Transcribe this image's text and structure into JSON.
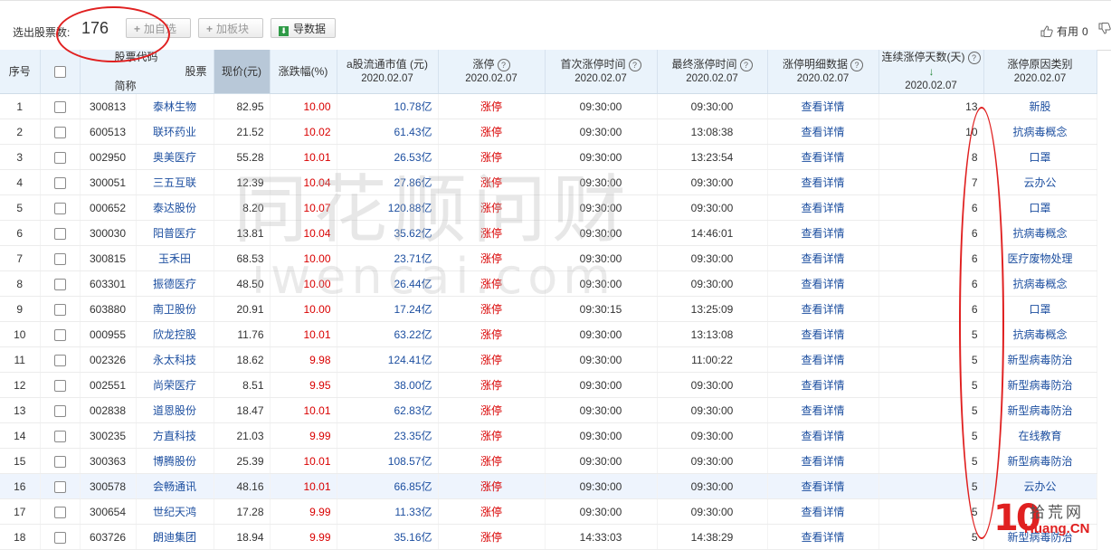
{
  "toolbar": {
    "selected_label": "选出股票数:",
    "selected_count": "176",
    "add_watchlist_label": "加自选",
    "add_block_label": "加板块",
    "export_label": "导数据",
    "useful_label": "有用",
    "useful_count": "0"
  },
  "columns": {
    "seq": "序号",
    "code": "股票代码",
    "name": "股票简称",
    "price": "现价(元)",
    "change": "涨跌幅(%)",
    "mktcap": "a股流通市值 (元)",
    "limitup": "涨停",
    "first_time": "首次涨停时间",
    "last_time": "最终涨停时间",
    "detail": "涨停明细数据",
    "streak": "连续涨停天数(天)",
    "reason": "涨停原因类别",
    "date": "2020.02.07"
  },
  "rows": [
    {
      "seq": "1",
      "code": "300813",
      "name": "泰林生物",
      "price": "82.95",
      "change": "10.00",
      "mktcap": "10.78亿",
      "limitup": "涨停",
      "first": "09:30:00",
      "last": "09:30:00",
      "detail": "查看详情",
      "streak": "13",
      "reason": "新股"
    },
    {
      "seq": "2",
      "code": "600513",
      "name": "联环药业",
      "price": "21.52",
      "change": "10.02",
      "mktcap": "61.43亿",
      "limitup": "涨停",
      "first": "09:30:00",
      "last": "13:08:38",
      "detail": "查看详情",
      "streak": "10",
      "reason": "抗病毒概念"
    },
    {
      "seq": "3",
      "code": "002950",
      "name": "奥美医疗",
      "price": "55.28",
      "change": "10.01",
      "mktcap": "26.53亿",
      "limitup": "涨停",
      "first": "09:30:00",
      "last": "13:23:54",
      "detail": "查看详情",
      "streak": "8",
      "reason": "口罩"
    },
    {
      "seq": "4",
      "code": "300051",
      "name": "三五互联",
      "price": "12.39",
      "change": "10.04",
      "mktcap": "27.86亿",
      "limitup": "涨停",
      "first": "09:30:00",
      "last": "09:30:00",
      "detail": "查看详情",
      "streak": "7",
      "reason": "云办公"
    },
    {
      "seq": "5",
      "code": "000652",
      "name": "泰达股份",
      "price": "8.20",
      "change": "10.07",
      "mktcap": "120.88亿",
      "limitup": "涨停",
      "first": "09:30:00",
      "last": "09:30:00",
      "detail": "查看详情",
      "streak": "6",
      "reason": "口罩"
    },
    {
      "seq": "6",
      "code": "300030",
      "name": "阳普医疗",
      "price": "13.81",
      "change": "10.04",
      "mktcap": "35.62亿",
      "limitup": "涨停",
      "first": "09:30:00",
      "last": "14:46:01",
      "detail": "查看详情",
      "streak": "6",
      "reason": "抗病毒概念"
    },
    {
      "seq": "7",
      "code": "300815",
      "name": "玉禾田",
      "price": "68.53",
      "change": "10.00",
      "mktcap": "23.71亿",
      "limitup": "涨停",
      "first": "09:30:00",
      "last": "09:30:00",
      "detail": "查看详情",
      "streak": "6",
      "reason": "医疗废物处理"
    },
    {
      "seq": "8",
      "code": "603301",
      "name": "振德医疗",
      "price": "48.50",
      "change": "10.00",
      "mktcap": "26.44亿",
      "limitup": "涨停",
      "first": "09:30:00",
      "last": "09:30:00",
      "detail": "查看详情",
      "streak": "6",
      "reason": "抗病毒概念"
    },
    {
      "seq": "9",
      "code": "603880",
      "name": "南卫股份",
      "price": "20.91",
      "change": "10.00",
      "mktcap": "17.24亿",
      "limitup": "涨停",
      "first": "09:30:15",
      "last": "13:25:09",
      "detail": "查看详情",
      "streak": "6",
      "reason": "口罩"
    },
    {
      "seq": "10",
      "code": "000955",
      "name": "欣龙控股",
      "price": "11.76",
      "change": "10.01",
      "mktcap": "63.22亿",
      "limitup": "涨停",
      "first": "09:30:00",
      "last": "13:13:08",
      "detail": "查看详情",
      "streak": "5",
      "reason": "抗病毒概念"
    },
    {
      "seq": "11",
      "code": "002326",
      "name": "永太科技",
      "price": "18.62",
      "change": "9.98",
      "mktcap": "124.41亿",
      "limitup": "涨停",
      "first": "09:30:00",
      "last": "11:00:22",
      "detail": "查看详情",
      "streak": "5",
      "reason": "新型病毒防治"
    },
    {
      "seq": "12",
      "code": "002551",
      "name": "尚荣医疗",
      "price": "8.51",
      "change": "9.95",
      "mktcap": "38.00亿",
      "limitup": "涨停",
      "first": "09:30:00",
      "last": "09:30:00",
      "detail": "查看详情",
      "streak": "5",
      "reason": "新型病毒防治"
    },
    {
      "seq": "13",
      "code": "002838",
      "name": "道恩股份",
      "price": "18.47",
      "change": "10.01",
      "mktcap": "62.83亿",
      "limitup": "涨停",
      "first": "09:30:00",
      "last": "09:30:00",
      "detail": "查看详情",
      "streak": "5",
      "reason": "新型病毒防治"
    },
    {
      "seq": "14",
      "code": "300235",
      "name": "方直科技",
      "price": "21.03",
      "change": "9.99",
      "mktcap": "23.35亿",
      "limitup": "涨停",
      "first": "09:30:00",
      "last": "09:30:00",
      "detail": "查看详情",
      "streak": "5",
      "reason": "在线教育"
    },
    {
      "seq": "15",
      "code": "300363",
      "name": "博腾股份",
      "price": "25.39",
      "change": "10.01",
      "mktcap": "108.57亿",
      "limitup": "涨停",
      "first": "09:30:00",
      "last": "09:30:00",
      "detail": "查看详情",
      "streak": "5",
      "reason": "新型病毒防治"
    },
    {
      "seq": "16",
      "code": "300578",
      "name": "会畅通讯",
      "price": "48.16",
      "change": "10.01",
      "mktcap": "66.85亿",
      "limitup": "涨停",
      "first": "09:30:00",
      "last": "09:30:00",
      "detail": "查看详情",
      "streak": "5",
      "reason": "云办公"
    },
    {
      "seq": "17",
      "code": "300654",
      "name": "世纪天鸿",
      "price": "17.28",
      "change": "9.99",
      "mktcap": "11.33亿",
      "limitup": "涨停",
      "first": "09:30:00",
      "last": "09:30:00",
      "detail": "查看详情",
      "streak": "5",
      "reason": ""
    },
    {
      "seq": "18",
      "code": "603726",
      "name": "朗迪集团",
      "price": "18.94",
      "change": "9.99",
      "mktcap": "35.16亿",
      "limitup": "涨停",
      "first": "14:33:03",
      "last": "14:38:29",
      "detail": "查看详情",
      "streak": "5",
      "reason": "新型病毒防治"
    }
  ],
  "watermark": {
    "line1": "同花顺问财",
    "line2": "iwencai.com"
  },
  "logo": {
    "number": "10",
    "name": "拾荒网",
    "domain": "Huang.CN"
  },
  "colors": {
    "link": "#1d4fa0",
    "up": "#d90000",
    "header_bg": "#eaf3fb",
    "annotation": "#e02020"
  }
}
